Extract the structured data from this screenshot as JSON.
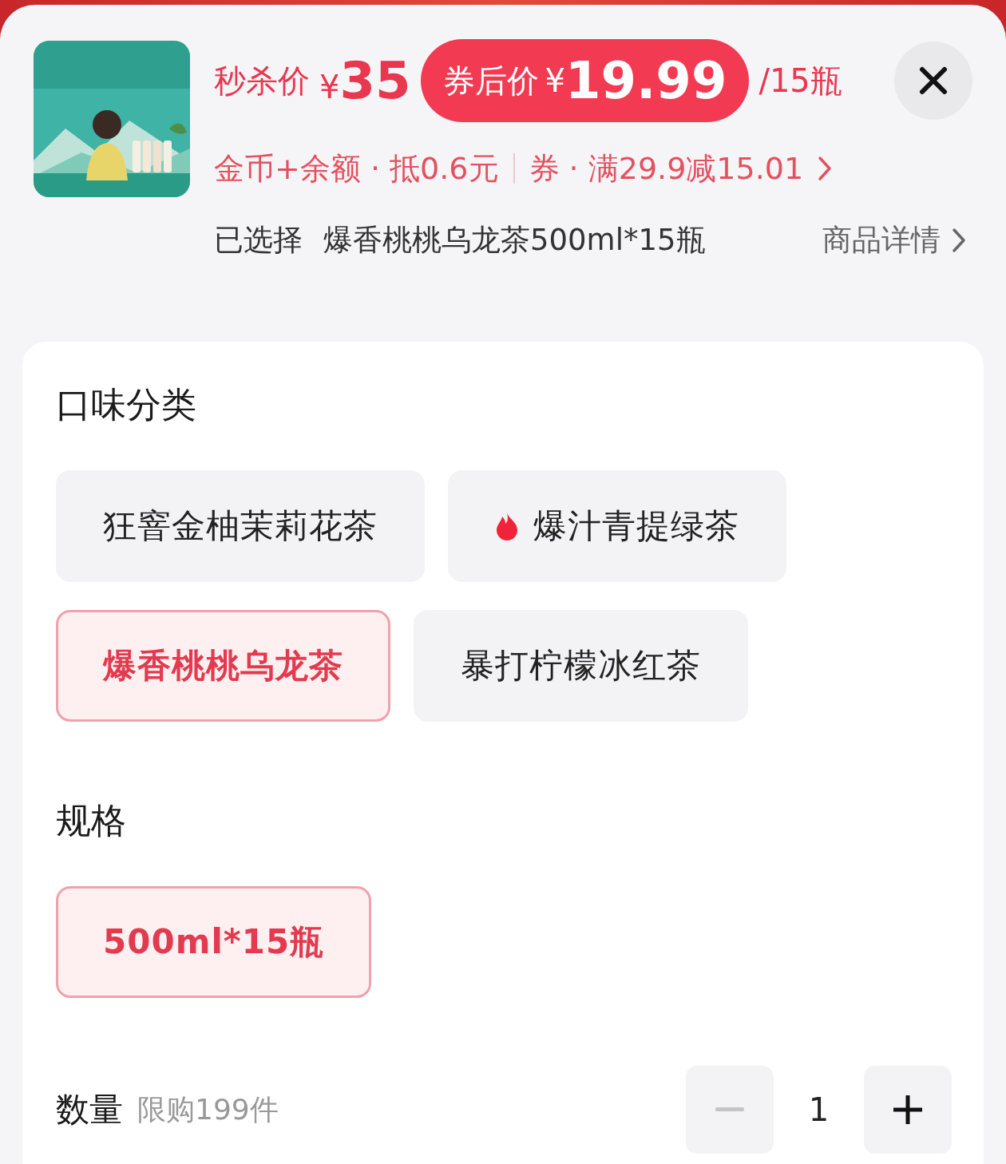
{
  "product": {
    "flash_label": "秒杀价",
    "flash_currency": "¥",
    "flash_price": "35",
    "coupon_label": "券后价",
    "coupon_currency": "¥",
    "coupon_price": "19.99",
    "unit": "/15瓶"
  },
  "discounts": [
    {
      "text": "金币+余额 · 抵0.6元"
    },
    {
      "text": "券 · 满29.9减15.01"
    }
  ],
  "selection": {
    "label": "已选择",
    "value": "爆香桃桃乌龙茶500ml*15瓶",
    "details_link": "商品详情"
  },
  "groups": [
    {
      "title": "口味分类",
      "options": [
        {
          "label": "狂窨金柚茉莉花茶",
          "selected": false,
          "hot": false
        },
        {
          "label": "爆汁青提绿茶",
          "selected": false,
          "hot": true
        },
        {
          "label": "爆香桃桃乌龙茶",
          "selected": true,
          "hot": false
        },
        {
          "label": "暴打柠檬冰红茶",
          "selected": false,
          "hot": false
        }
      ]
    },
    {
      "title": "规格",
      "options": [
        {
          "label": "500ml*15瓶",
          "selected": true,
          "hot": false
        }
      ]
    }
  ],
  "quantity": {
    "label": "数量",
    "limit": "限购199件",
    "value": "1",
    "decrement_disabled": true,
    "increment_disabled": false
  }
}
